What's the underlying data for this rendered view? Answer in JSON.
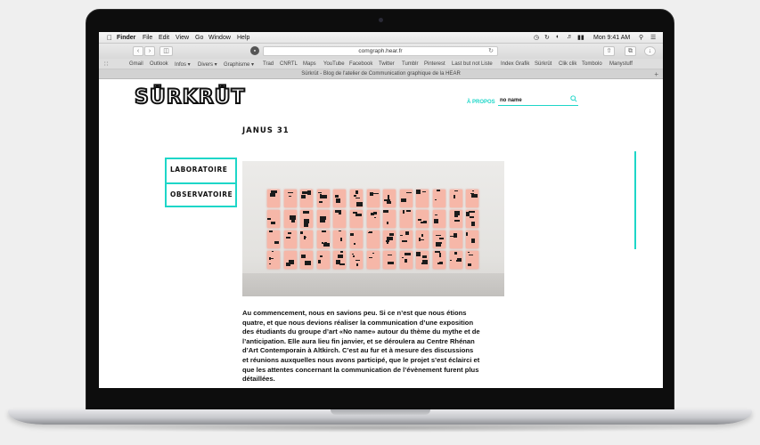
{
  "menubar": {
    "app": "Finder",
    "items": [
      "File",
      "Edit",
      "View",
      "Go",
      "Window",
      "Help"
    ],
    "clock": "Mon 9:41 AM"
  },
  "toolbar": {
    "url": "comgraph.hear.fr"
  },
  "favorites": [
    "Gmail",
    "Outlook",
    "Infos ▾",
    "Divers ▾",
    "Graphisme ▾",
    "Trad",
    "CNRTL",
    "Maps",
    "YouTube",
    "Facebook",
    "Twitter",
    "Tumblr",
    "Pinterest",
    "Last but not Liste",
    "Index Grafik",
    "Sürkrüt",
    "Clik clik",
    "Tombolo",
    "Manystuff"
  ],
  "tab": {
    "title": "Sürkrüt - Blog de l'atelier de Communication graphique de la HEAR"
  },
  "site": {
    "logo": "SÜRKRÜT",
    "about_label": "À PROPOS",
    "search_value": "no name",
    "nav": [
      "LABORATOIRE",
      "OBSERVATOIRE"
    ],
    "accent_color": "#1ed6c8"
  },
  "post": {
    "title": "JANUS 31",
    "body_lines": [
      "Au commencement, nous en savions peu. Si ce n’est que nous étions",
      "quatre, et que nous devions réaliser la communication d’une exposition",
      "des étudiants du groupe d’art «No name» autour du thème du mythe et de",
      "l’anticipation. Elle aura lieu fin janvier, et se déroulera au Centre Rhénan",
      "d’Art Contemporain à Altkirch. C’est au fur et à mesure des discussions",
      "et réunions auxquelles nous avons participé, que le projet s’est éclairci et",
      "que les attentes concernant la communication de l’évènement furent plus",
      "détaillées."
    ]
  }
}
